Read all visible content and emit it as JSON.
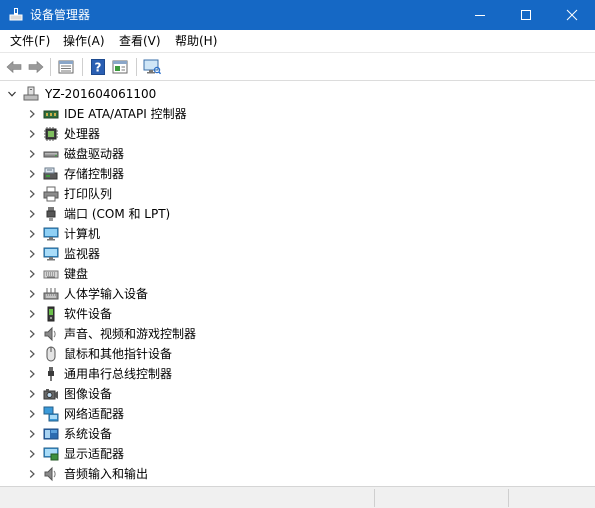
{
  "window": {
    "title": "设备管理器",
    "controls": [
      "minimize-icon",
      "maximize-icon",
      "close-icon"
    ]
  },
  "menu": [
    "文件(F)",
    "操作(A)",
    "查看(V)",
    "帮助(H)"
  ],
  "toolbar": {
    "buttons": [
      "back-arrow-icon",
      "forward-arrow-icon",
      "properties-icon",
      "help-icon",
      "update-driver-icon",
      "scan-hardware-icon"
    ]
  },
  "tree": {
    "root": "YZ-201604061100",
    "root_icon": "computer-root-icon",
    "categories": [
      {
        "label": "IDE ATA/ATAPI 控制器",
        "icon": "ide-controller-icon"
      },
      {
        "label": "处理器",
        "icon": "processor-icon"
      },
      {
        "label": "磁盘驱动器",
        "icon": "disk-drive-icon"
      },
      {
        "label": "存储控制器",
        "icon": "storage-controller-icon"
      },
      {
        "label": "打印队列",
        "icon": "printer-icon"
      },
      {
        "label": "端口 (COM 和 LPT)",
        "icon": "port-icon"
      },
      {
        "label": "计算机",
        "icon": "computer-icon"
      },
      {
        "label": "监视器",
        "icon": "monitor-icon"
      },
      {
        "label": "键盘",
        "icon": "keyboard-icon"
      },
      {
        "label": "人体学输入设备",
        "icon": "hid-icon"
      },
      {
        "label": "软件设备",
        "icon": "software-device-icon"
      },
      {
        "label": "声音、视频和游戏控制器",
        "icon": "sound-icon"
      },
      {
        "label": "鼠标和其他指针设备",
        "icon": "mouse-icon"
      },
      {
        "label": "通用串行总线控制器",
        "icon": "usb-icon"
      },
      {
        "label": "图像设备",
        "icon": "camera-icon"
      },
      {
        "label": "网络适配器",
        "icon": "network-adapter-icon"
      },
      {
        "label": "系统设备",
        "icon": "system-device-icon"
      },
      {
        "label": "显示适配器",
        "icon": "display-adapter-icon"
      },
      {
        "label": "音频输入和输出",
        "icon": "audio-io-icon"
      }
    ]
  },
  "colors": {
    "titlebar": "#1568c5",
    "statusbar": "#f0f0f0"
  }
}
